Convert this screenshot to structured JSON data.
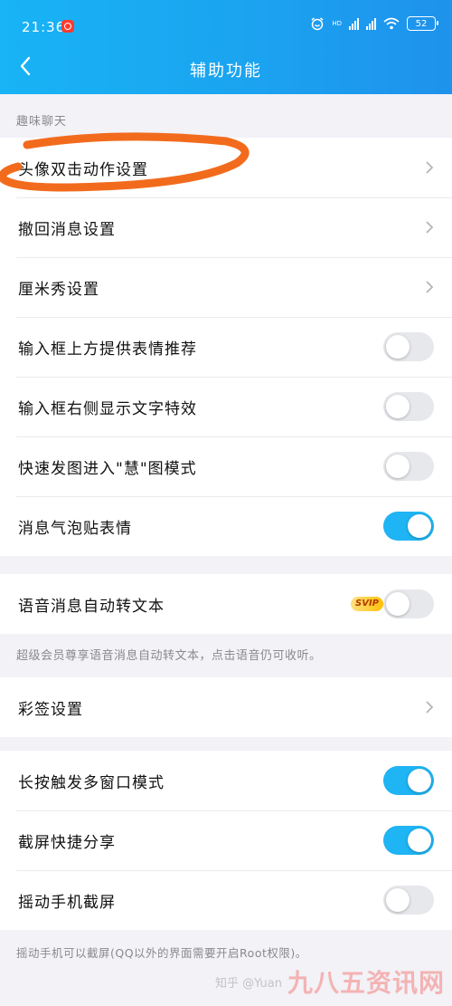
{
  "status_bar": {
    "time": "21:36",
    "battery": "52",
    "network": "HD"
  },
  "header": {
    "title": "辅助功能"
  },
  "sections": {
    "fun_chat": "趣味聊天"
  },
  "group1": {
    "items": [
      {
        "label": "头像双击动作设置",
        "control": "chevron"
      },
      {
        "label": "撤回消息设置",
        "control": "chevron"
      },
      {
        "label": "厘米秀设置",
        "control": "chevron"
      },
      {
        "label": "输入框上方提供表情推荐",
        "control": "toggle",
        "on": false
      },
      {
        "label": "输入框右侧显示文字特效",
        "control": "toggle",
        "on": false
      },
      {
        "label": "快速发图进入\"慧\"图模式",
        "control": "toggle",
        "on": false
      },
      {
        "label": "消息气泡贴表情",
        "control": "toggle",
        "on": true
      }
    ]
  },
  "group2": {
    "label": "语音消息自动转文本",
    "badge": "SVIP",
    "on": false,
    "note": "超级会员尊享语音消息自动转文本，点击语音仍可收听。"
  },
  "group3": {
    "label": "彩签设置"
  },
  "group4": {
    "items": [
      {
        "label": "长按触发多窗口模式",
        "on": true
      },
      {
        "label": "截屏快捷分享",
        "on": true
      },
      {
        "label": "摇动手机截屏",
        "on": false
      }
    ],
    "note": "摇动手机可以截屏(QQ以外的界面需要开启Root权限)。"
  },
  "watermark": {
    "source": "知乎 @Yuan",
    "site": "九八五资讯网"
  },
  "colors": {
    "accent": "#1fb4f3",
    "annotation": "#f26b1d"
  }
}
